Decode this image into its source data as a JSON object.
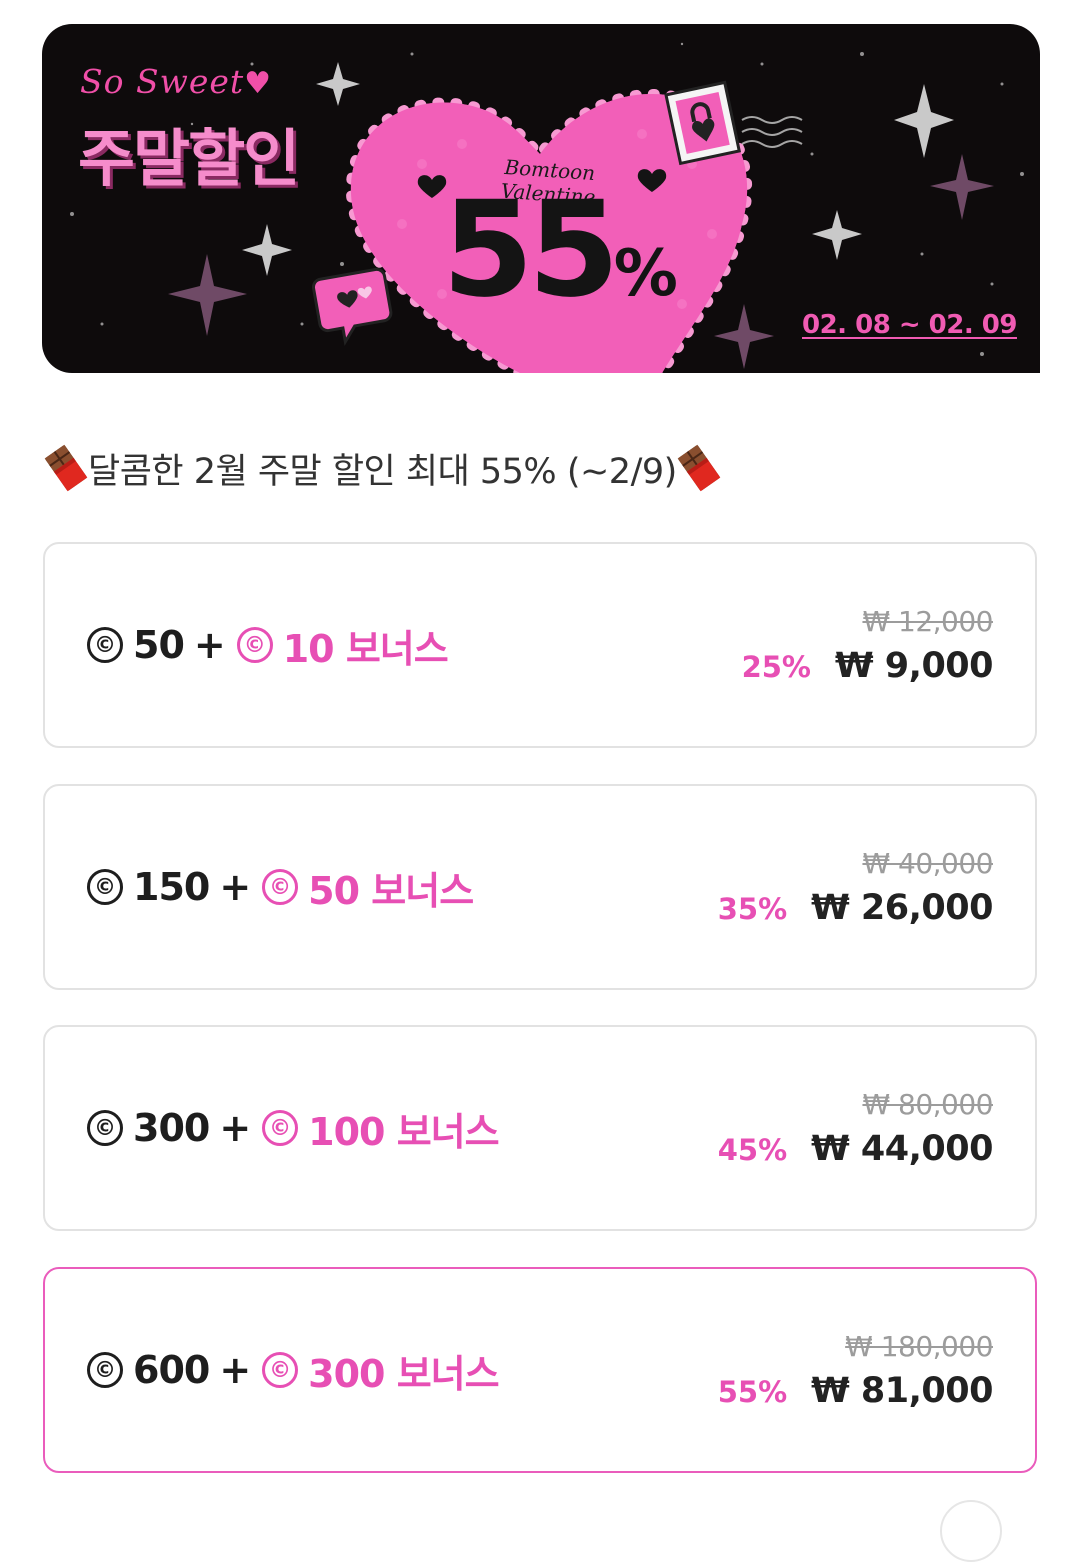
{
  "banner": {
    "tagline": "So Sweet",
    "title": "주말할인",
    "subtitle": "Bomtoon Valentine",
    "percent_value": "55",
    "percent_sign": "%",
    "date_range": "02. 08 ~ 02. 09",
    "colors": {
      "background": "#0e0b0c",
      "heart": "#f25fb8",
      "accent": "#f05bb3"
    }
  },
  "heading": {
    "icon": "chocolate-bar-icon",
    "text": "달콤한 2월 주말 할인 최대 55% (~2/9)"
  },
  "currency_icon": "©",
  "products": [
    {
      "base_amount": "50",
      "bonus": "10 보너스",
      "original_price": "₩ 12,000",
      "discount": "25%",
      "price": "₩ 9,000",
      "selected": false
    },
    {
      "base_amount": "150",
      "bonus": "50 보너스",
      "original_price": "₩ 40,000",
      "discount": "35%",
      "price": "₩ 26,000",
      "selected": false
    },
    {
      "base_amount": "300",
      "bonus": "100 보너스",
      "original_price": "₩ 80,000",
      "discount": "45%",
      "price": "₩ 44,000",
      "selected": false
    },
    {
      "base_amount": "600",
      "bonus": "300 보너스",
      "original_price": "₩ 180,000",
      "discount": "55%",
      "price": "₩ 81,000",
      "selected": true
    }
  ],
  "colors": {
    "accent_pink": "#e74fb4",
    "card_border": "#e2e2e2",
    "selected_border": "#ea5cbc",
    "strike_gray": "#9c9c9c"
  }
}
